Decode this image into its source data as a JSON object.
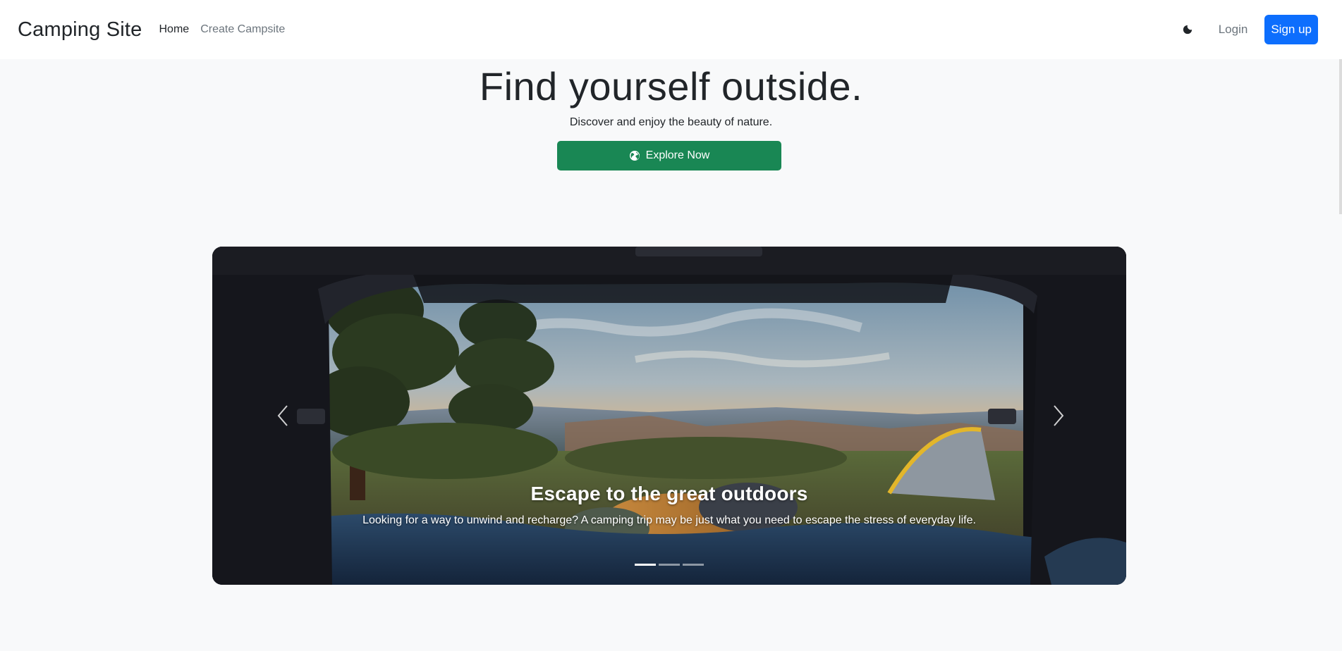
{
  "navbar": {
    "brand": "Camping Site",
    "links": [
      {
        "label": "Home",
        "active": true
      },
      {
        "label": "Create Campsite",
        "active": false
      }
    ],
    "theme_icon": "moon-icon",
    "login_label": "Login",
    "signup_label": "Sign up"
  },
  "hero": {
    "title": "Find yourself outside.",
    "subtitle": "Discover and enjoy the beauty of nature.",
    "cta_label": "Explore Now",
    "cta_icon": "globe-icon"
  },
  "carousel": {
    "caption_title": "Escape to the great outdoors",
    "caption_text": "Looking for a way to unwind and recharge? A camping trip may be just what you need to escape the stress of everyday life.",
    "prev_icon": "chevron-left-icon",
    "next_icon": "chevron-right-icon",
    "slide_count": 3,
    "active_slide": 1
  },
  "colors": {
    "primary": "#0d6efd",
    "success": "#198754",
    "background": "#f8f9fa"
  }
}
